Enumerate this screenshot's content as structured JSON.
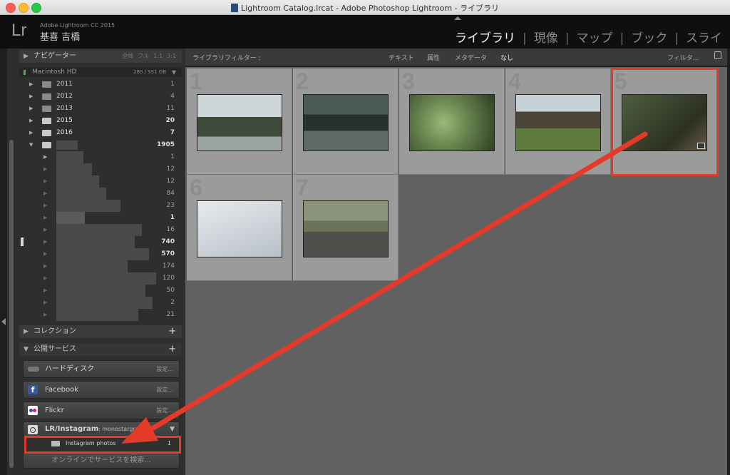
{
  "window": {
    "title": "Lightroom Catalog.lrcat - Adobe Photoshop Lightroom - ライブラリ"
  },
  "app": {
    "name": "Adobe Lightroom CC 2015",
    "user": "基喜 吉橋",
    "logo": "Lr"
  },
  "modules": [
    {
      "label": "ライブラリ",
      "active": true
    },
    {
      "label": "現像"
    },
    {
      "label": "マップ"
    },
    {
      "label": "ブック"
    },
    {
      "label": "スライ"
    }
  ],
  "navigator": {
    "label": "ナビゲーター",
    "options": [
      "全体",
      "フル",
      "1:1",
      "3:1"
    ]
  },
  "volume": {
    "name": "Macintosh HD",
    "space": "280 / 931 GB"
  },
  "folders": [
    {
      "name": "2011",
      "count": "1"
    },
    {
      "name": "2012",
      "count": "4"
    },
    {
      "name": "2013",
      "count": "11"
    },
    {
      "name": "2015",
      "count": "20"
    },
    {
      "name": "2016",
      "count": "7"
    },
    {
      "name": "",
      "count": "1905"
    },
    {
      "name": "",
      "count": "1"
    },
    {
      "name": "",
      "count": "12"
    },
    {
      "name": "",
      "count": "12"
    },
    {
      "name": "",
      "count": "84"
    },
    {
      "name": "",
      "count": "23"
    },
    {
      "name": "",
      "count": "1"
    },
    {
      "name": "",
      "count": "16"
    },
    {
      "name": "",
      "count": "740"
    },
    {
      "name": "",
      "count": "570"
    },
    {
      "name": "",
      "count": "174"
    },
    {
      "name": "",
      "count": "120"
    },
    {
      "name": "",
      "count": "50"
    },
    {
      "name": "",
      "count": "2"
    },
    {
      "name": "",
      "count": "21"
    }
  ],
  "collections": {
    "label": "コレクション"
  },
  "publish": {
    "label": "公開サービス",
    "services": [
      {
        "name": "ハードディスク",
        "settings": "設定..."
      },
      {
        "name": "Facebook",
        "settings": "設定..."
      },
      {
        "name": "Flickr",
        "settings": "設定..."
      }
    ],
    "instagram": {
      "name": "LR/Instagram",
      "account": ": monestargram",
      "collection": "Instagram photos",
      "count": "1"
    },
    "find_more": "オンラインでサービスを検索..."
  },
  "filterbar": {
    "label": "ライブラリフィルター :",
    "text": "テキスト",
    "attribute": "属性",
    "metadata": "メタデータ",
    "none": "なし",
    "filter_menu": "フィルタ..."
  },
  "grid": {
    "cells": [
      {
        "num": "1",
        "colors": [
          "#cfd6da",
          "#3f4b3a"
        ]
      },
      {
        "num": "2",
        "colors": [
          "#4b5a55",
          "#27322f"
        ]
      },
      {
        "num": "3",
        "colors": [
          "#6f8d55",
          "#2e3f24"
        ]
      },
      {
        "num": "4",
        "colors": [
          "#c7d2d8",
          "#4a4538"
        ]
      },
      {
        "num": "5",
        "colors": [
          "#4e5e3e",
          "#2c3022"
        ]
      },
      {
        "num": "6",
        "colors": [
          "#e7ebef",
          "#b8c0c7"
        ]
      },
      {
        "num": "7",
        "colors": [
          "#8a947a",
          "#4e4e4a"
        ]
      }
    ]
  },
  "colors": {
    "accent_red": "#e33a2a"
  }
}
